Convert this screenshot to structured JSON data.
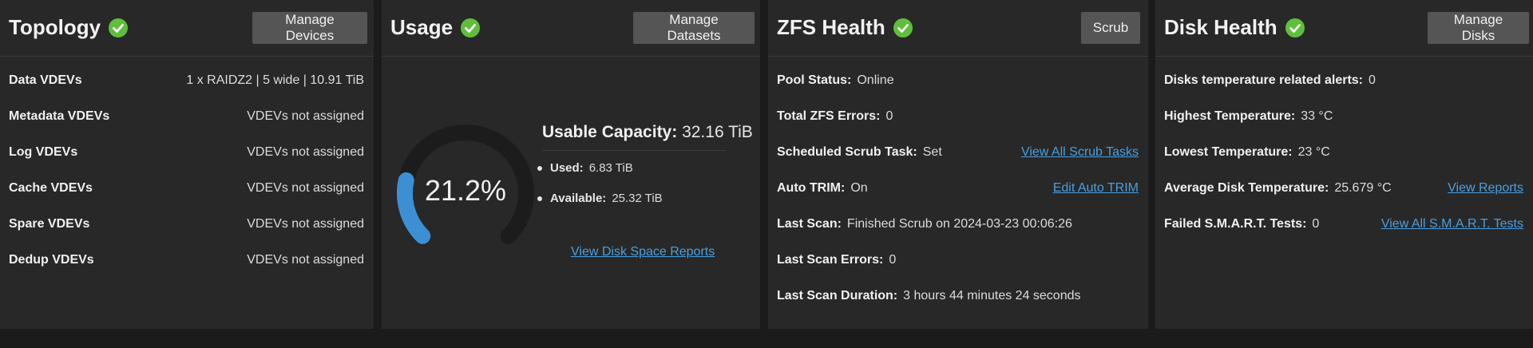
{
  "colors": {
    "ok_green": "#5fbf3c",
    "ring_blue": "#3d8fd4",
    "link_blue": "#4a9fe0"
  },
  "topology": {
    "title": "Topology",
    "button": "Manage Devices",
    "rows": [
      {
        "label": "Data VDEVs",
        "value": "1 x RAIDZ2 | 5 wide | 10.91 TiB"
      },
      {
        "label": "Metadata VDEVs",
        "value": "VDEVs not assigned"
      },
      {
        "label": "Log VDEVs",
        "value": "VDEVs not assigned"
      },
      {
        "label": "Cache VDEVs",
        "value": "VDEVs not assigned"
      },
      {
        "label": "Spare VDEVs",
        "value": "VDEVs not assigned"
      },
      {
        "label": "Dedup VDEVs",
        "value": "VDEVs not assigned"
      }
    ]
  },
  "usage": {
    "title": "Usage",
    "button": "Manage Datasets",
    "percent_text": "21.2%",
    "percent_value": 0.212,
    "capacity_label": "Usable Capacity:",
    "capacity_value": "32.16 TiB",
    "used_label": "Used:",
    "used_value": "6.83 TiB",
    "available_label": "Available:",
    "available_value": "25.32 TiB",
    "link": "View Disk Space Reports"
  },
  "zfs": {
    "title": "ZFS Health",
    "button": "Scrub",
    "rows": [
      {
        "label": "Pool Status:",
        "value": "Online"
      },
      {
        "label": "Total ZFS Errors:",
        "value": "0"
      },
      {
        "label": "Scheduled Scrub Task:",
        "value": "Set",
        "link": "View All Scrub Tasks"
      },
      {
        "label": "Auto TRIM:",
        "value": "On",
        "link": "Edit Auto TRIM"
      },
      {
        "label": "Last Scan:",
        "value": "Finished Scrub on 2024-03-23 00:06:26"
      },
      {
        "label": "Last Scan Errors:",
        "value": "0"
      },
      {
        "label": "Last Scan Duration:",
        "value": "3 hours 44 minutes 24 seconds"
      }
    ]
  },
  "disk": {
    "title": "Disk Health",
    "button": "Manage Disks",
    "rows": [
      {
        "label": "Disks temperature related alerts:",
        "value": "0"
      },
      {
        "label": "Highest Temperature:",
        "value": "33 °C"
      },
      {
        "label": "Lowest Temperature:",
        "value": "23 °C"
      },
      {
        "label": "Average Disk Temperature:",
        "value": "25.679 °C",
        "link": "View Reports"
      },
      {
        "label": "Failed S.M.A.R.T. Tests:",
        "value": "0",
        "link": "View All S.M.A.R.T. Tests"
      }
    ]
  }
}
